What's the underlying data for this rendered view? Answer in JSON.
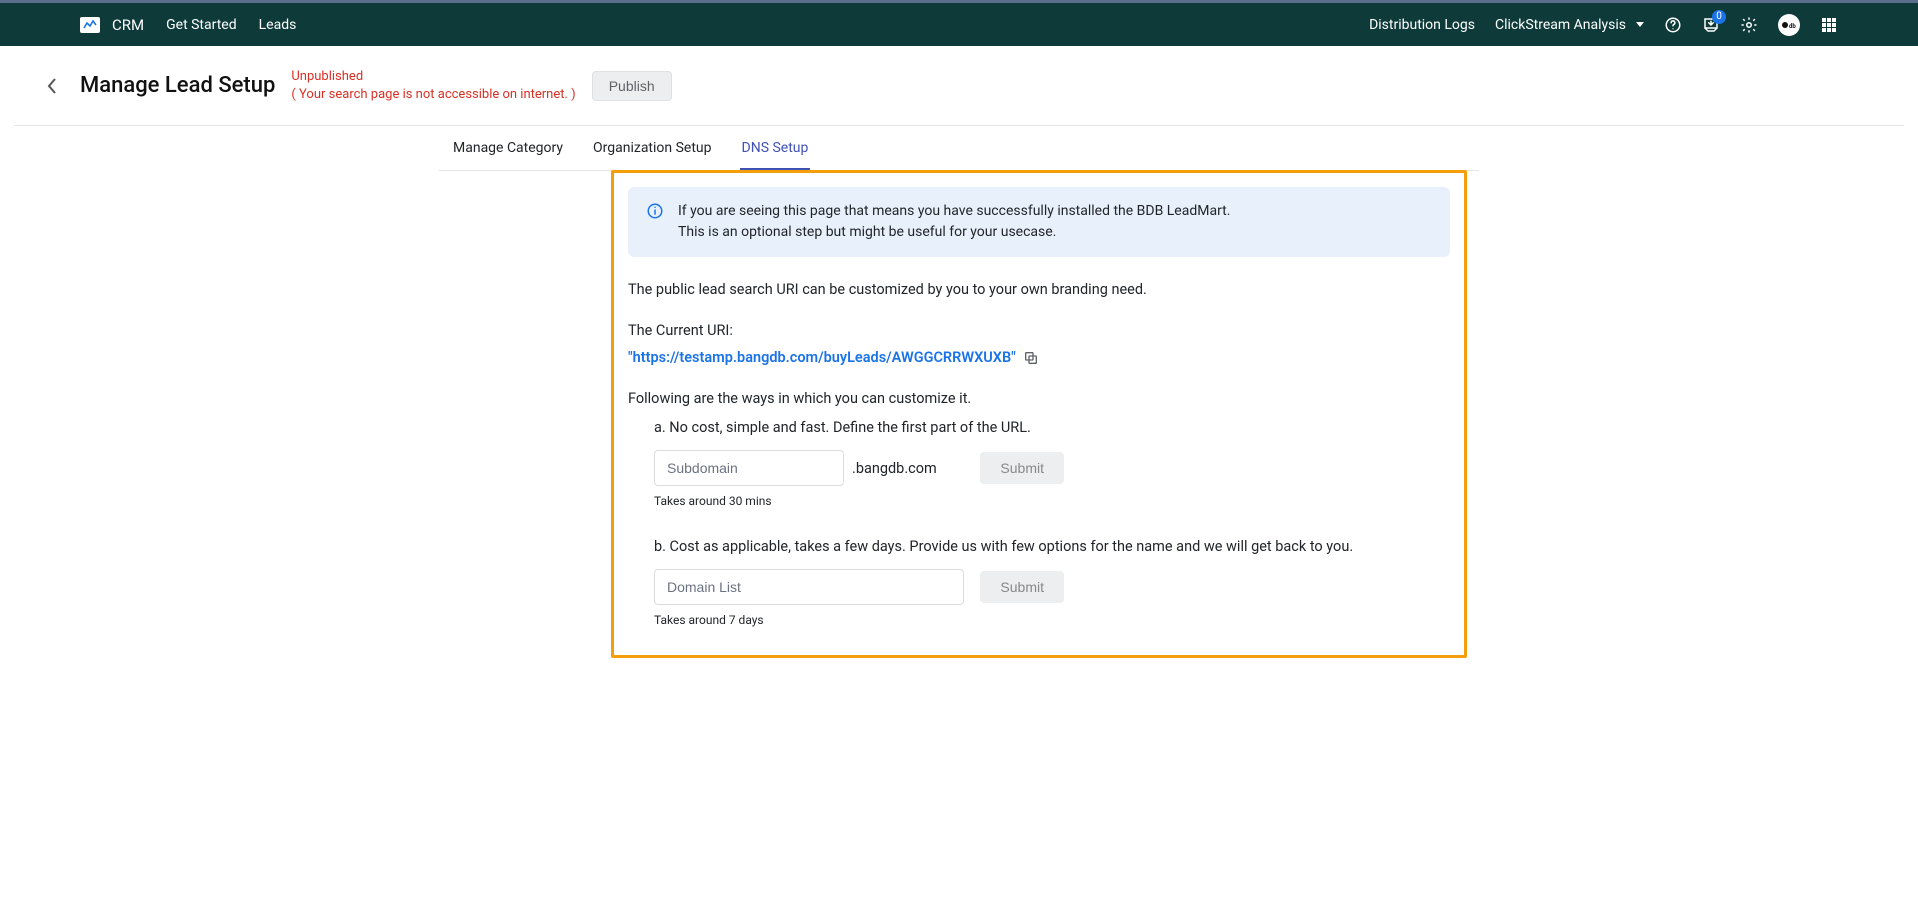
{
  "nav": {
    "brand": "CRM",
    "items": [
      "Get Started",
      "Leads"
    ],
    "right_links": {
      "distribution": "Distribution Logs",
      "clickstream": "ClickStream Analysis"
    },
    "inbox_badge": "0"
  },
  "header": {
    "title": "Manage Lead Setup",
    "status_line1": "Unpublished",
    "status_line2": "( Your search page is not accessible on internet. )",
    "publish_label": "Publish"
  },
  "tabs": {
    "items": [
      "Manage Category",
      "Organization Setup",
      "DNS Setup"
    ],
    "active_index": 2
  },
  "content": {
    "info_line1": "If you are seeing this page that means you have successfully installed the BDB LeadMart.",
    "info_line2": "This is an optional step but might be useful for your usecase.",
    "intro": "The public lead search URI can be customized by you to your own branding need.",
    "current_uri_label": "The Current URI:",
    "current_uri": "\"https://testamp.bangdb.com/buyLeads/AWGGCRRWXUXB\"",
    "ways_intro": "Following are the ways in which you can customize it.",
    "option_a": {
      "heading": "a. No cost, simple and fast. Define the first part of the URL.",
      "placeholder": "Subdomain",
      "suffix": ".bangdb.com",
      "submit": "Submit",
      "helper": "Takes around 30 mins"
    },
    "option_b": {
      "heading": "b. Cost as applicable, takes a few days. Provide us with few options for the name and we will get back to you.",
      "placeholder": "Domain List",
      "submit": "Submit",
      "helper": "Takes around 7 days"
    }
  }
}
